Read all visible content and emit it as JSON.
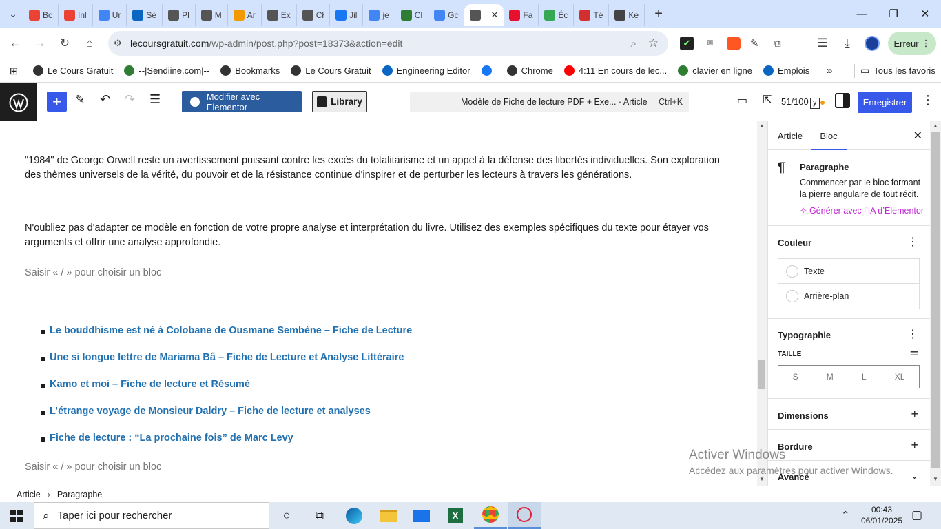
{
  "browser": {
    "tabs": [
      {
        "label": "Bc",
        "color": "#ea4335"
      },
      {
        "label": "Inl",
        "color": "#ea4335"
      },
      {
        "label": "Ur",
        "color": "#4285f4"
      },
      {
        "label": "Sé",
        "color": "#0a66c2"
      },
      {
        "label": "Pl",
        "color": "#555555"
      },
      {
        "label": "M",
        "color": "#555555"
      },
      {
        "label": "Ar",
        "color": "#f29900"
      },
      {
        "label": "Ex",
        "color": "#555555"
      },
      {
        "label": "Cł",
        "color": "#555555"
      },
      {
        "label": "Jil",
        "color": "#1877f2"
      },
      {
        "label": "je",
        "color": "#4285f4"
      },
      {
        "label": "Cl",
        "color": "#2e7d32"
      },
      {
        "label": "Gc",
        "color": "#4285f4"
      },
      {
        "label": "",
        "color": "#555555",
        "active": true
      },
      {
        "label": "Fa",
        "color": "#e8112d"
      },
      {
        "label": "Éc",
        "color": "#34a853"
      },
      {
        "label": "Té",
        "color": "#d32f2f"
      },
      {
        "label": "Ke",
        "color": "#444444"
      }
    ],
    "url_host": "lecoursgratuit.com",
    "url_path": "/wp-admin/post.php?post=18373&action=edit",
    "profile_label": "Erreur",
    "bookmarks": [
      {
        "label": "Le Cours Gratuit",
        "color": "#333333"
      },
      {
        "label": "--|Sendiine.com|--",
        "color": "#2e7d32"
      },
      {
        "label": "Bookmarks",
        "color": "#333333"
      },
      {
        "label": "Le Cours Gratuit",
        "color": "#333333"
      },
      {
        "label": "Engineering Editor",
        "color": "#0a66c2"
      },
      {
        "label": "",
        "color": "#1877f2"
      },
      {
        "label": "Chrome",
        "color": "#333333"
      },
      {
        "label": "4:11 En cours de lec...",
        "color": "#ff0000"
      },
      {
        "label": "clavier en ligne",
        "color": "#2e7d32"
      },
      {
        "label": "Emplois",
        "color": "#0a66c2"
      }
    ],
    "all_favorites": "Tous les favoris"
  },
  "wp": {
    "elementor_button": "Modifier avec Elementor",
    "library_button": "Library",
    "doc_title": "Modèle de Fiche de lecture PDF + Exe... · Article",
    "shortcut": "Ctrl+K",
    "seo_score": "51/100",
    "save_button": "Enregistrer"
  },
  "content": {
    "para1": "\"1984\" de George Orwell reste un avertissement puissant contre les excès du totalitarisme et un appel à la défense des libertés individuelles. Son exploration des thèmes universels de la vérité, du pouvoir et de la résistance continue d'inspirer et de perturber les lecteurs à travers les générations.",
    "para2": "N'oubliez pas d'adapter ce modèle en fonction de votre propre analyse et interprétation du livre. Utilisez des exemples spécifiques du texte pour étayer vos arguments et offrir une analyse approfondie.",
    "placeholder": "Saisir « / » pour choisir un bloc",
    "links": [
      "Le bouddhisme est né à Colobane de Ousmane Sembène – Fiche de Lecture",
      "Une si longue lettre de Mariama Bâ – Fiche de Lecture et Analyse Littéraire",
      "Kamo et moi – Fiche de lecture et Résumé",
      "L’étrange voyage de Monsieur Daldry – Fiche de lecture et analyses",
      "Fiche de lecture : “La prochaine fois” de Marc Levy"
    ]
  },
  "sidebar": {
    "tab_article": "Article",
    "tab_bloc": "Bloc",
    "block_name": "Paragraphe",
    "block_desc": "Commencer par le bloc formant la pierre angulaire de tout récit.",
    "ai_link": "Générer avec l’IA d’Elementor",
    "color_title": "Couleur",
    "color_text": "Texte",
    "color_bg": "Arrière-plan",
    "typo_title": "Typographie",
    "size_label": "TAILLE",
    "sizes": [
      "S",
      "M",
      "L",
      "XL"
    ],
    "dimensions": "Dimensions",
    "border": "Bordure",
    "advanced": "Avancé"
  },
  "breadcrumb": {
    "root": "Article",
    "current": "Paragraphe"
  },
  "watermark": {
    "title": "Activer Windows",
    "subtitle": "Accédez aux paramètres pour activer Windows."
  },
  "taskbar": {
    "search_placeholder": "Taper ici pour rechercher",
    "time": "00:43",
    "date": "06/01/2025"
  },
  "colors": {
    "wp_blue": "#3858e9",
    "elementor_blue": "#2b5c9e",
    "link_blue": "#2271b1",
    "ai_pink": "#c026d3"
  }
}
